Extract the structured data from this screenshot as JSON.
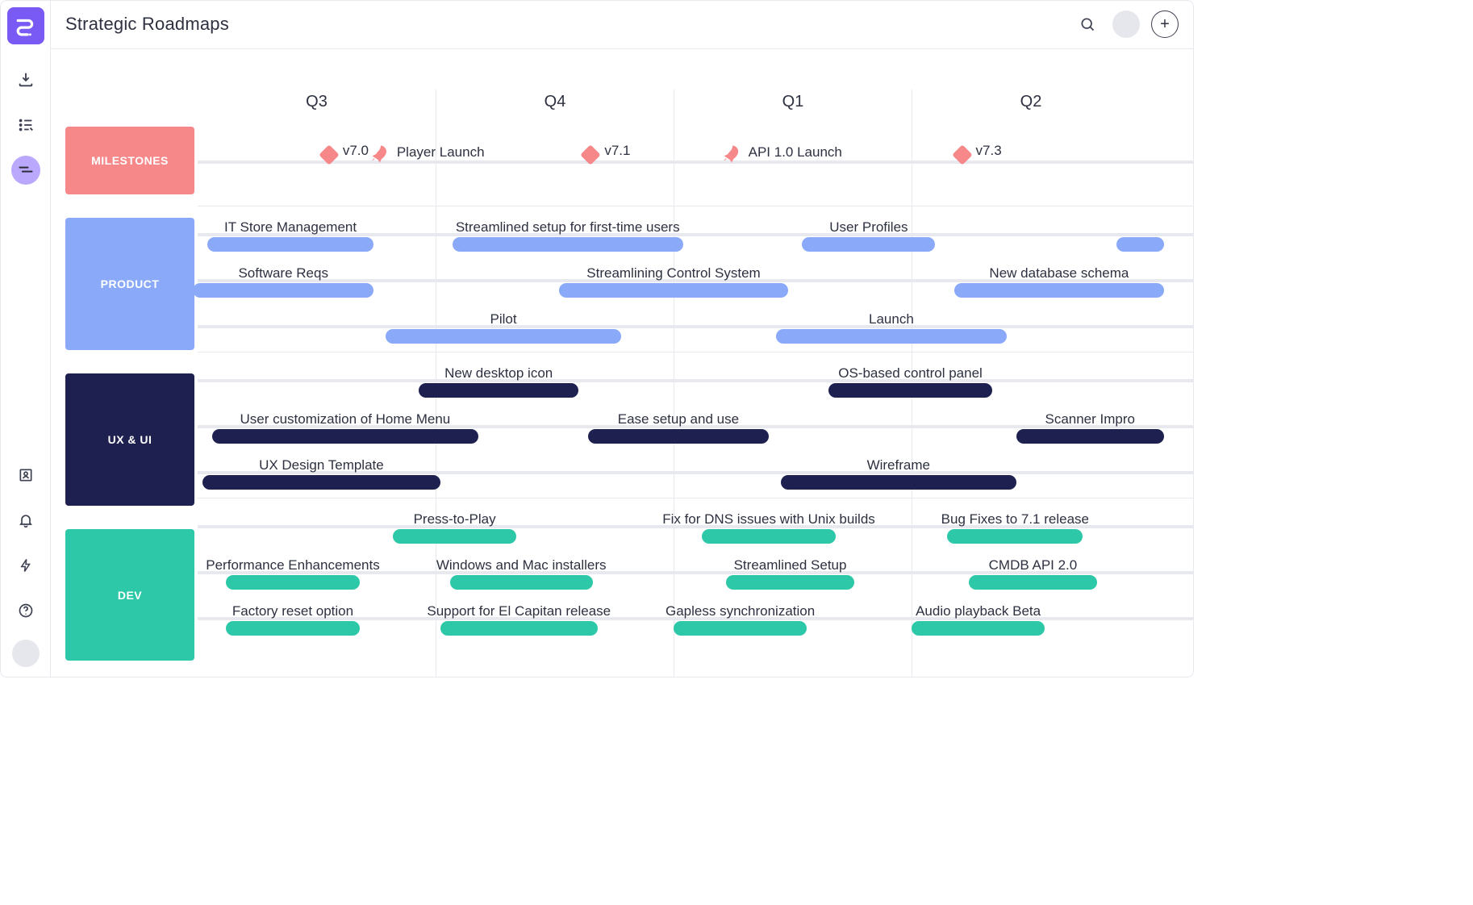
{
  "header": {
    "title": "Strategic Roadmaps",
    "add_glyph": "+"
  },
  "quarters": [
    "Q3",
    "Q4",
    "Q1",
    "Q2"
  ],
  "chart_data": {
    "type": "gantt",
    "x_unit": "quarter",
    "x_categories": [
      "Q3",
      "Q4",
      "Q1",
      "Q2"
    ],
    "x_range": [
      0,
      4
    ],
    "lanes": [
      {
        "id": "milestones",
        "name": "MILESTONES",
        "color": "#f68889",
        "kind": "milestones",
        "rows": [
          {
            "milestones": [
              {
                "label": "v7.0",
                "at": 0.62,
                "icon": "diamond"
              },
              {
                "label": "Player Launch",
                "at": 0.96,
                "icon": "rocket"
              },
              {
                "label": "v7.1",
                "at": 1.72,
                "icon": "diamond"
              },
              {
                "label": "API 1.0 Launch",
                "at": 2.45,
                "icon": "rocket"
              },
              {
                "label": "v7.3",
                "at": 3.28,
                "icon": "diamond"
              }
            ]
          }
        ]
      },
      {
        "id": "product",
        "name": "PRODUCT",
        "color": "#8aa9f9",
        "kind": "bars",
        "rows": [
          {
            "bars": [
              {
                "label": "IT Store Management",
                "start": 0.04,
                "end": 0.74
              },
              {
                "label": "Streamlined setup for first-time users",
                "start": 1.07,
                "end": 2.04
              },
              {
                "label": "User Profiles",
                "start": 2.54,
                "end": 3.1
              },
              {
                "label": "",
                "start": 3.86,
                "end": 4.06
              }
            ]
          },
          {
            "bars": [
              {
                "label": "Software Reqs",
                "start": -0.02,
                "end": 0.74
              },
              {
                "label": "Streamlining Control System",
                "start": 1.52,
                "end": 2.48
              },
              {
                "label": "New database schema",
                "start": 3.18,
                "end": 4.06
              }
            ]
          },
          {
            "bars": [
              {
                "label": "Pilot",
                "start": 0.79,
                "end": 1.78
              },
              {
                "label": "Launch",
                "start": 2.43,
                "end": 3.4
              }
            ]
          }
        ]
      },
      {
        "id": "uxui",
        "name": "UX & UI",
        "color": "#1e204f",
        "kind": "bars",
        "rows": [
          {
            "bars": [
              {
                "label": "New desktop icon",
                "start": 0.93,
                "end": 1.6
              },
              {
                "label": "OS-based control panel",
                "start": 2.65,
                "end": 3.34
              }
            ]
          },
          {
            "bars": [
              {
                "label": "User customization of Home Menu",
                "start": 0.06,
                "end": 1.18
              },
              {
                "label": "Ease setup and use",
                "start": 1.64,
                "end": 2.4
              },
              {
                "label": "Scanner Impro",
                "start": 3.44,
                "end": 4.06
              }
            ]
          },
          {
            "bars": [
              {
                "label": "UX Design Template",
                "start": 0.02,
                "end": 1.02
              },
              {
                "label": "Wireframe",
                "start": 2.45,
                "end": 3.44
              }
            ]
          }
        ]
      },
      {
        "id": "dev",
        "name": "DEV",
        "color": "#2dc8a8",
        "kind": "bars",
        "rows": [
          {
            "bars": [
              {
                "label": "Press-to-Play",
                "start": 0.82,
                "end": 1.34
              },
              {
                "label": "Fix for DNS issues with Unix builds",
                "start": 2.12,
                "end": 2.68
              },
              {
                "label": "Bug Fixes to 7.1 release",
                "start": 3.15,
                "end": 3.72
              }
            ]
          },
          {
            "bars": [
              {
                "label": "Performance Enhancements",
                "start": 0.12,
                "end": 0.68
              },
              {
                "label": "Windows and Mac installers",
                "start": 1.06,
                "end": 1.66
              },
              {
                "label": "Streamlined Setup",
                "start": 2.22,
                "end": 2.76
              },
              {
                "label": "CMDB API 2.0",
                "start": 3.24,
                "end": 3.78
              }
            ]
          },
          {
            "bars": [
              {
                "label": "Factory reset option",
                "start": 0.12,
                "end": 0.68
              },
              {
                "label": "Support for El Capitan release",
                "start": 1.02,
                "end": 1.68
              },
              {
                "label": "Gapless synchronization",
                "start": 2.0,
                "end": 2.56
              },
              {
                "label": "Audio playback Beta",
                "start": 3.0,
                "end": 3.56
              }
            ]
          }
        ]
      }
    ]
  }
}
